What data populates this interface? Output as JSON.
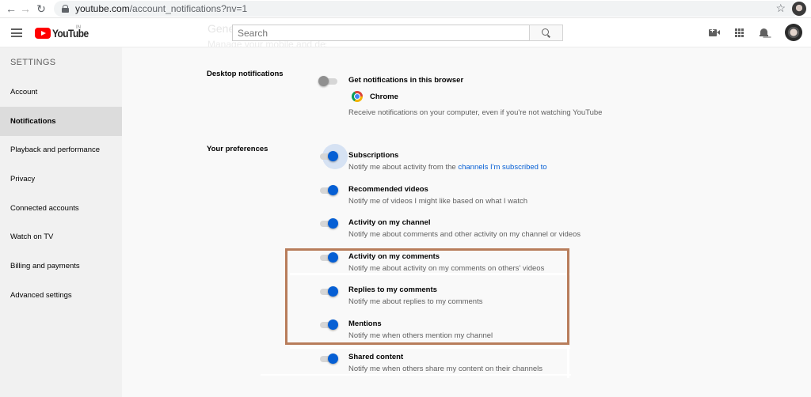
{
  "browser": {
    "url_host": "youtube.com",
    "url_path": "/account_notifications?nv=1",
    "icons": {
      "back": "arrow-left-icon",
      "forward": "arrow-right-icon",
      "reload": "reload-icon",
      "lock": "lock-icon",
      "bookmark": "star-icon"
    }
  },
  "header": {
    "logo_text": "YouTube",
    "logo_region": "IN",
    "ghost_title": "General",
    "ghost_subtitle": "Manage your mobile and desktop notifications",
    "search_placeholder": "Search",
    "icons": [
      "menu-icon",
      "search-icon",
      "create-video-icon",
      "apps-icon",
      "notifications-bell-icon",
      "avatar"
    ]
  },
  "sidebar": {
    "heading": "SETTINGS",
    "items": [
      {
        "label": "Account",
        "active": false
      },
      {
        "label": "Notifications",
        "active": true
      },
      {
        "label": "Playback and performance",
        "active": false
      },
      {
        "label": "Privacy",
        "active": false
      },
      {
        "label": "Connected accounts",
        "active": false
      },
      {
        "label": "Watch on TV",
        "active": false
      },
      {
        "label": "Billing and payments",
        "active": false
      },
      {
        "label": "Advanced settings",
        "active": false
      }
    ]
  },
  "desktop": {
    "label": "Desktop notifications",
    "toggle_on": false,
    "title": "Get notifications in this browser",
    "browser_name": "Chrome",
    "description": "Receive notifications on your computer, even if you're not watching YouTube"
  },
  "preferences": {
    "label": "Your preferences",
    "items": [
      {
        "title": "Subscriptions",
        "desc_prefix": "Notify me about activity from the ",
        "desc_link": "channels I'm subscribed to",
        "on": true,
        "focused": true
      },
      {
        "title": "Recommended videos",
        "desc": "Notify me of videos I might like based on what I watch",
        "on": true
      },
      {
        "title": "Activity on my channel",
        "desc": "Notify me about comments and other activity on my channel or videos",
        "on": true
      },
      {
        "title": "Activity on my comments",
        "desc": "Notify me about activity on my comments on others' videos",
        "on": true
      },
      {
        "title": "Replies to my comments",
        "desc": "Notify me about replies to my comments",
        "on": true
      },
      {
        "title": "Mentions",
        "desc": "Notify me when others mention my channel",
        "on": true
      },
      {
        "title": "Shared content",
        "desc": "Notify me when others share my content on their channels",
        "on": true
      }
    ]
  },
  "colors": {
    "accent": "#065fd4",
    "brand_red": "#ff0000",
    "highlight_box": "#b87d5b",
    "sidebar_bg": "#f1f1f1",
    "sidebar_active": "#dcdcdc"
  }
}
